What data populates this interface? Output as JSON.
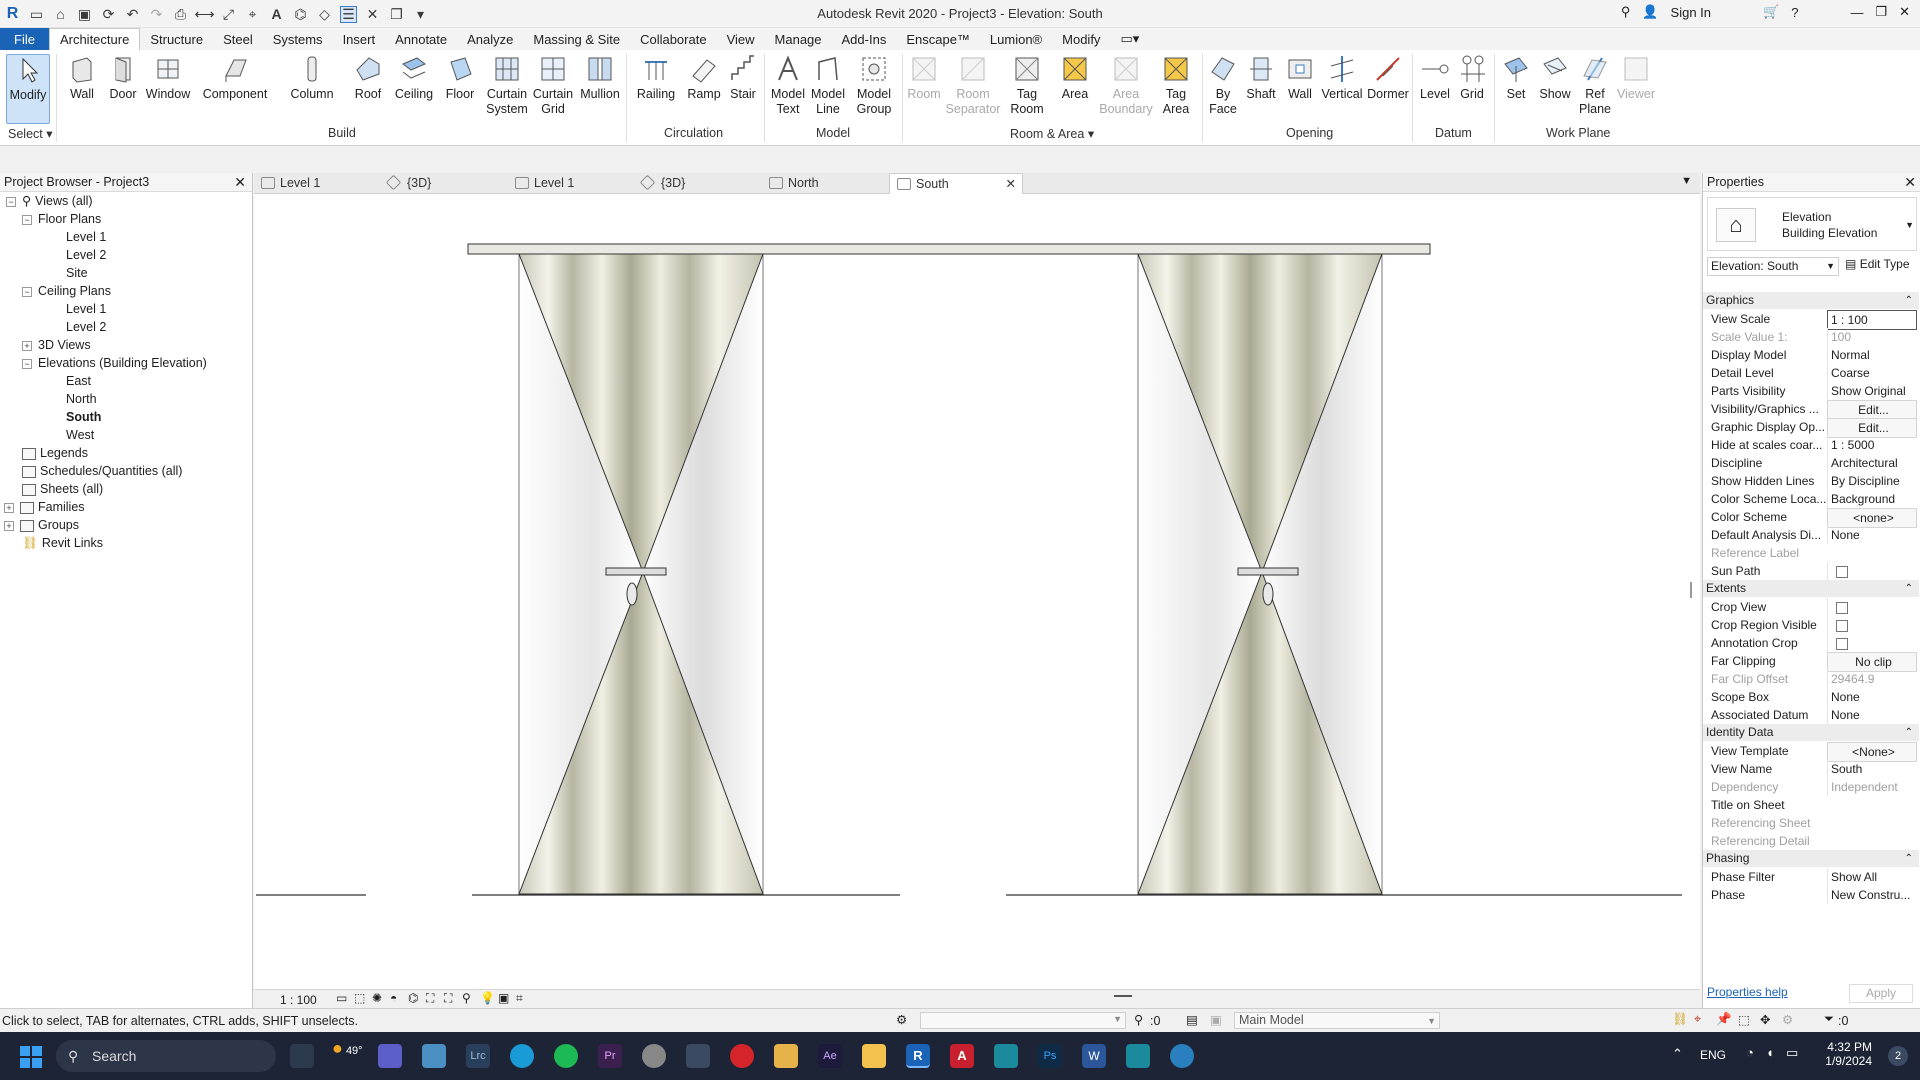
{
  "titlebar": {
    "title": "Autodesk Revit 2020 - Project3 - Elevation: South",
    "sign_in": "Sign In"
  },
  "ribbon_tabs": [
    "File",
    "Architecture",
    "Structure",
    "Steel",
    "Systems",
    "Insert",
    "Annotate",
    "Analyze",
    "Massing & Site",
    "Collaborate",
    "View",
    "Manage",
    "Add-Ins",
    "Enscape™",
    "Lumion®",
    "Modify"
  ],
  "ribbon": {
    "buttons": {
      "modify": "Modify",
      "wall": "Wall",
      "door": "Door",
      "window": "Window",
      "component": "Component",
      "column": "Column",
      "roof": "Roof",
      "ceiling": "Ceiling",
      "floor": "Floor",
      "curtain_system_1": "Curtain",
      "curtain_system_2": "System",
      "curtain_grid_1": "Curtain",
      "curtain_grid_2": "Grid",
      "mullion": "Mullion",
      "railing": "Railing",
      "ramp": "Ramp",
      "stair": "Stair",
      "model_text_1": "Model",
      "model_text_2": "Text",
      "model_line_1": "Model",
      "model_line_2": "Line",
      "model_group_1": "Model",
      "model_group_2": "Group",
      "room": "Room",
      "room_sep_1": "Room",
      "room_sep_2": "Separator",
      "tag_room_1": "Tag",
      "tag_room_2": "Room",
      "area": "Area",
      "area_boundary_1": "Area",
      "area_boundary_2": "Boundary",
      "tag_area_1": "Tag",
      "tag_area_2": "Area",
      "by_face_1": "By",
      "by_face_2": "Face",
      "shaft": "Shaft",
      "wall_open": "Wall",
      "vertical": "Vertical",
      "dormer": "Dormer",
      "level": "Level",
      "grid": "Grid",
      "set": "Set",
      "show": "Show",
      "ref_plane_1": "Ref",
      "ref_plane_2": "Plane",
      "viewer": "Viewer"
    },
    "panels": {
      "select": "Select",
      "build": "Build",
      "circulation": "Circulation",
      "model": "Model",
      "room_area": "Room & Area",
      "opening": "Opening",
      "datum": "Datum",
      "work_plane": "Work Plane"
    }
  },
  "project_browser": {
    "title": "Project Browser - Project3",
    "items": {
      "views_all": "Views (all)",
      "floor_plans": "Floor Plans",
      "fp_level1": "Level 1",
      "fp_level2": "Level 2",
      "fp_site": "Site",
      "ceiling_plans": "Ceiling Plans",
      "cp_level1": "Level 1",
      "cp_level2": "Level 2",
      "views_3d": "3D Views",
      "elevations": "Elevations (Building Elevation)",
      "east": "East",
      "north": "North",
      "south": "South",
      "west": "West",
      "legends": "Legends",
      "schedules": "Schedules/Quantities (all)",
      "sheets": "Sheets (all)",
      "families": "Families",
      "groups": "Groups",
      "revit_links": "Revit Links"
    }
  },
  "view_tabs": [
    "Level 1",
    "{3D}",
    "Level 1",
    "{3D}",
    "North",
    "South"
  ],
  "view_scale": "1 : 100",
  "properties": {
    "title": "Properties",
    "type_name_1": "Elevation",
    "type_name_2": "Building Elevation",
    "selector": "Elevation: South",
    "edit_type": "Edit Type",
    "sections": {
      "graphics": "Graphics",
      "extents": "Extents",
      "identity": "Identity Data",
      "phasing": "Phasing"
    },
    "graphics": [
      [
        "View Scale",
        "1 : 100"
      ],
      [
        "Scale Value    1:",
        "100"
      ],
      [
        "Display Model",
        "Normal"
      ],
      [
        "Detail Level",
        "Coarse"
      ],
      [
        "Parts Visibility",
        "Show Original"
      ],
      [
        "Visibility/Graphics ...",
        "Edit..."
      ],
      [
        "Graphic Display Op...",
        "Edit..."
      ],
      [
        "Hide at scales coar...",
        "1 : 5000"
      ],
      [
        "Discipline",
        "Architectural"
      ],
      [
        "Show Hidden Lines",
        "By Discipline"
      ],
      [
        "Color Scheme Loca...",
        "Background"
      ],
      [
        "Color Scheme",
        "<none>"
      ],
      [
        "Default Analysis Di...",
        "None"
      ],
      [
        "Reference Label",
        ""
      ],
      [
        "Sun Path",
        ""
      ]
    ],
    "extents": [
      [
        "Crop View",
        ""
      ],
      [
        "Crop Region Visible",
        ""
      ],
      [
        "Annotation Crop",
        ""
      ],
      [
        "Far Clipping",
        "No clip"
      ],
      [
        "Far Clip Offset",
        "29464.9"
      ],
      [
        "Scope Box",
        "None"
      ],
      [
        "Associated Datum",
        "None"
      ]
    ],
    "identity": [
      [
        "View Template",
        "<None>"
      ],
      [
        "View Name",
        "South"
      ],
      [
        "Dependency",
        "Independent"
      ],
      [
        "Title on Sheet",
        ""
      ],
      [
        "Referencing Sheet",
        ""
      ],
      [
        "Referencing Detail",
        ""
      ]
    ],
    "phasing": [
      [
        "Phase Filter",
        "Show All"
      ],
      [
        "Phase",
        "New Constru..."
      ]
    ],
    "help_link": "Properties help",
    "apply": "Apply"
  },
  "statusbar": {
    "hint": "Click to select, TAB for alternates, CTRL adds, SHIFT unselects.",
    "zero": ":0",
    "main_model": "Main Model",
    "filter_count": ":0"
  },
  "taskbar": {
    "search": "Search",
    "temp": "49°",
    "lang": "ENG",
    "time": "4:32 PM",
    "date": "1/9/2024",
    "notif": "2"
  }
}
